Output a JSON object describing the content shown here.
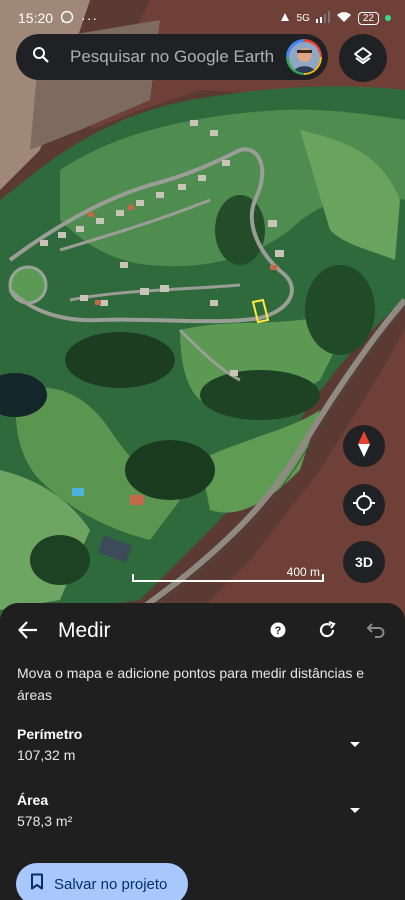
{
  "status_bar": {
    "time": "15:20",
    "network": "5G",
    "battery": "22",
    "dots": "···"
  },
  "search": {
    "placeholder": "Pesquisar no Google Earth"
  },
  "map": {
    "scale_label": "400 m",
    "btn_3d_label": "3D"
  },
  "measure_panel": {
    "title": "Medir",
    "instructions": "Mova o mapa e adicione pontos para medir distâncias e áreas",
    "perimeter": {
      "label": "Perímetro",
      "value": "107,32 m"
    },
    "area": {
      "label": "Área",
      "value": "578,3 m²"
    },
    "save_label": "Salvar no projeto"
  },
  "colors": {
    "panel_bg": "#1f1f1f",
    "button_bg": "#202124",
    "save_bg": "#a8c7fa",
    "save_text": "#062e6f",
    "measure_outline": "#ffeb3b",
    "compass_red": "#ea4335"
  }
}
